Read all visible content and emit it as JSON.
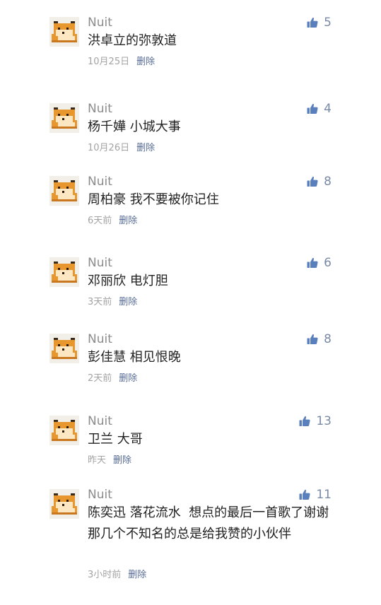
{
  "comments": [
    {
      "user": "Nuit",
      "text": "洪卓立的弥敦道",
      "time": "10月25日",
      "delete": "删除",
      "likes": "5"
    },
    {
      "user": "Nuit",
      "text": "杨千嬅 小城大事",
      "time": "10月26日",
      "delete": "删除",
      "likes": "4"
    },
    {
      "user": "Nuit",
      "text": "周柏豪 我不要被你记住",
      "time": "6天前",
      "delete": "删除",
      "likes": "8"
    },
    {
      "user": "Nuit",
      "text": "邓丽欣 电灯胆",
      "time": "3天前",
      "delete": "删除",
      "likes": "6"
    },
    {
      "user": "Nuit",
      "text": "彭佳慧 相见恨晚",
      "time": "2天前",
      "delete": "删除",
      "likes": "8"
    },
    {
      "user": "Nuit",
      "text": "卫兰 大哥",
      "time": "昨天",
      "delete": "删除",
      "likes": "13"
    },
    {
      "user": "Nuit",
      "text": "陈奕迅 落花流水  想点的最后一首歌了谢谢那几个不知名的总是给我赞的小伙伴",
      "time": "3小时前",
      "delete": "删除",
      "likes": "11"
    }
  ],
  "icons": {
    "avatar": "pixel-shiba-dog-icon",
    "like": "thumbs-up-icon"
  },
  "colors": {
    "delete_link": "#576b95",
    "like_icon": "#5a7fbd",
    "username": "#8c8c8c",
    "meta": "#a3a3a3"
  }
}
